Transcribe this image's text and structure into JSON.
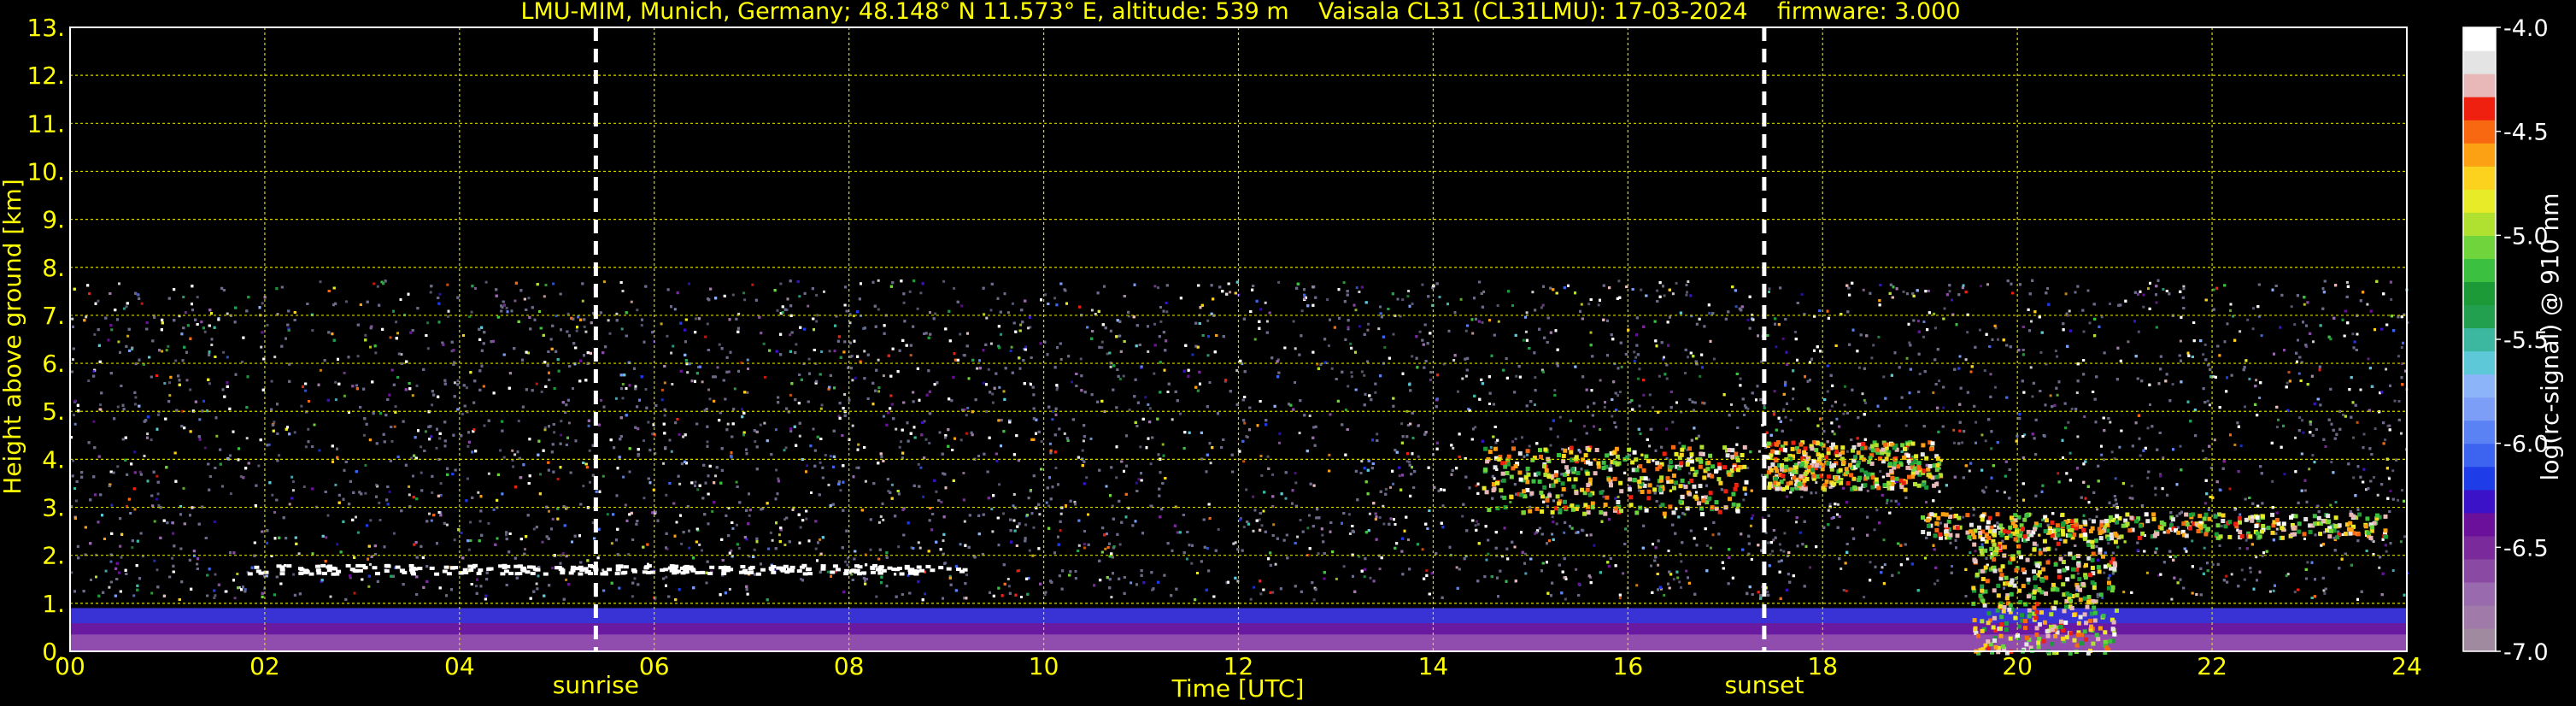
{
  "chart_data": {
    "type": "heatmap",
    "title": "LMU-MIM, Munich, Germany; 48.148° N 11.573° E, altitude: 539 m    Vaisala CL31 (CL31LMU): 17-03-2024    firmware: 3.000",
    "xlabel": "Time [UTC]",
    "ylabel": "Height above ground [km]",
    "xlim": [
      0,
      24
    ],
    "ylim": [
      0,
      13
    ],
    "x_ticks": [
      "00",
      "02",
      "04",
      "06",
      "08",
      "10",
      "12",
      "14",
      "16",
      "18",
      "20",
      "22",
      "24"
    ],
    "y_ticks": [
      "0.",
      "1.",
      "2.",
      "3.",
      "4.",
      "5.",
      "6.",
      "7.",
      "8.",
      "9.",
      "10.",
      "11.",
      "12.",
      "13."
    ],
    "grid": true,
    "markers": [
      {
        "label": "sunrise",
        "time_h": 5.4
      },
      {
        "label": "sunset",
        "time_h": 17.4
      }
    ],
    "signal_ceiling_km": 7.75,
    "colorbar": {
      "label": "log(rc-signal) @ 910 nm",
      "ticks": [
        "-4.0",
        "-4.5",
        "-5.0",
        "-5.5",
        "-6.0",
        "-6.5",
        "-7.0"
      ],
      "range": [
        -7.0,
        -4.0
      ],
      "colors": [
        "#a08aa0",
        "#a07aa8",
        "#9a6aae",
        "#8a4aa4",
        "#7a2a9a",
        "#6a109a",
        "#3c12c8",
        "#1e3ce8",
        "#3c64f0",
        "#5a82f4",
        "#7c9ef6",
        "#8cb4f8",
        "#5cc8d8",
        "#3cb8a0",
        "#22a050",
        "#1c9a38",
        "#3cc040",
        "#70d43c",
        "#b0e030",
        "#e8ec28",
        "#fcd21e",
        "#fca014",
        "#f86810",
        "#f02010",
        "#e8b8b8",
        "#e4e4e4",
        "#ffffff"
      ]
    },
    "features": [
      {
        "type": "boundary_layer",
        "time_h": [
          0,
          24
        ],
        "top_km": 0.9
      },
      {
        "type": "cloud_layer",
        "time_h": [
          1.8,
          9.3
        ],
        "height_km": 1.75
      },
      {
        "type": "cloud_fragments",
        "time_h": [
          14.5,
          17.2
        ],
        "height_km": [
          2.9,
          4.3
        ]
      },
      {
        "type": "cloud_layer",
        "time_h": [
          17.4,
          19.2
        ],
        "height_km": [
          3.4,
          4.4
        ]
      },
      {
        "type": "cloud_layer",
        "time_h": [
          19.0,
          23.8
        ],
        "height_km": [
          2.4,
          2.9
        ]
      },
      {
        "type": "precipitation",
        "time_h": [
          19.5,
          21.0
        ],
        "height_km": [
          0,
          2.6
        ]
      }
    ]
  }
}
